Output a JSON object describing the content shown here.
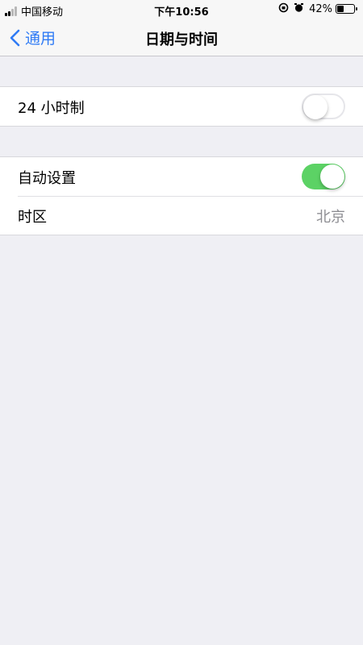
{
  "status_bar": {
    "carrier": "中国移动",
    "time": "下午10:56",
    "battery": "42%",
    "battery_level": 0.42,
    "icons": [
      "signal-icon",
      "orientation-lock-icon",
      "alarm-icon",
      "battery-icon"
    ]
  },
  "nav": {
    "back_label": "通用",
    "title": "日期与时间",
    "accent_color": "#2f7bf5"
  },
  "settings": {
    "hour24_label": "24 小时制",
    "hour24_on": false,
    "auto_label": "自动设置",
    "auto_on": true,
    "timezone_label": "时区",
    "timezone_value": "北京",
    "toggle_on_color": "#5cd265"
  }
}
